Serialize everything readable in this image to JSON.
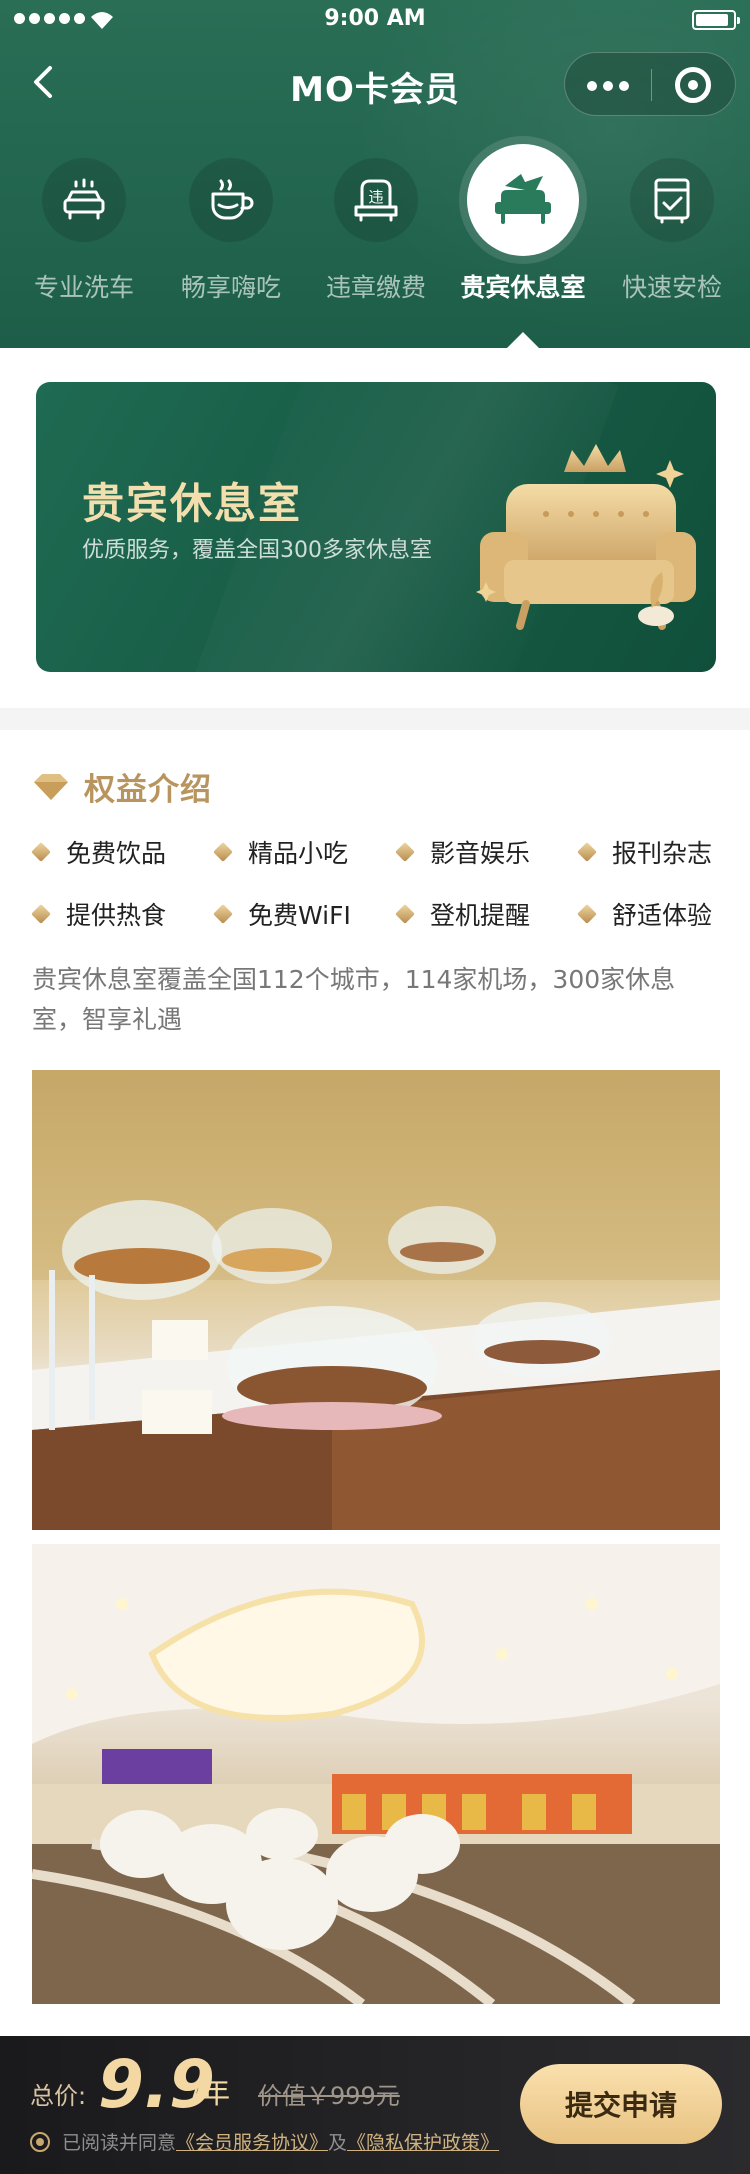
{
  "status_bar": {
    "time": "9:00 AM"
  },
  "nav": {
    "title": "MO卡会员"
  },
  "services": [
    {
      "label": "专业洗车",
      "icon": "car-wash-icon",
      "active": false
    },
    {
      "label": "畅享嗨吃",
      "icon": "coffee-cup-icon",
      "active": false
    },
    {
      "label": "违章缴费",
      "icon": "violation-car-icon",
      "active": false
    },
    {
      "label": "贵宾休息室",
      "icon": "vip-lounge-sofa-icon",
      "active": true
    },
    {
      "label": "快速安检",
      "icon": "security-check-icon",
      "active": false
    }
  ],
  "banner": {
    "title": "贵宾休息室",
    "subtitle": "优质服务，覆盖全国300多家休息室"
  },
  "benefits": {
    "title": "权益介绍",
    "features": [
      "免费饮品",
      "精品小吃",
      "影音娱乐",
      "报刊杂志",
      "提供热食",
      "免费WiFI",
      "登机提醒",
      "舒适体验"
    ],
    "description": "贵宾休息室覆盖全国112个城市，114家机场，300家休息室，智享礼遇"
  },
  "bottom_bar": {
    "price_label": "总价:",
    "price_value": "9.9",
    "price_unit": "/年",
    "original_price": "价值￥999元",
    "agree_prefix": "已阅读并同意",
    "agreement_link": "《会员服务协议》",
    "agree_and": "及",
    "privacy_link": "《隐私保护政策》",
    "submit_label": "提交申请"
  },
  "colors": {
    "header_green": "#1d5e49",
    "gold": "#b8955e",
    "button_gold": "#f3d8a3",
    "bottom_bar": "#1a1a1c"
  }
}
